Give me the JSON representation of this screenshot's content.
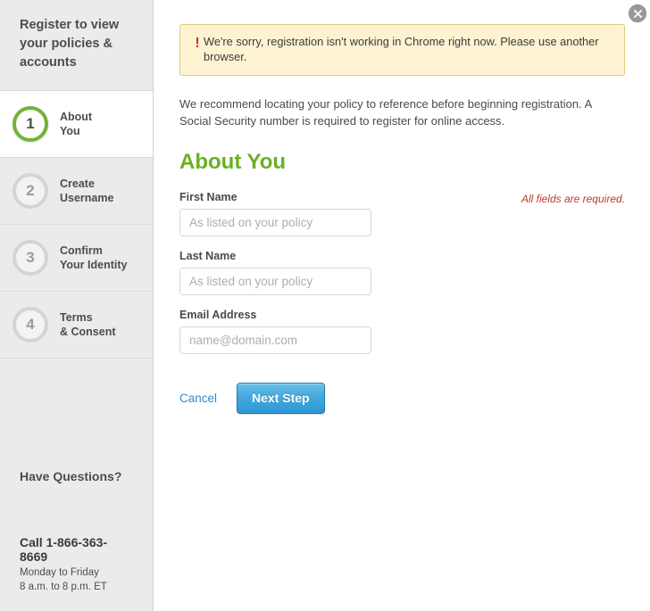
{
  "window": {
    "close_icon": "close-icon"
  },
  "sidebar": {
    "title": "Register to view your policies & accounts",
    "steps": [
      {
        "number": "1",
        "label": "About\nYou",
        "active": true
      },
      {
        "number": "2",
        "label": "Create\nUsername",
        "active": false
      },
      {
        "number": "3",
        "label": "Confirm\nYour Identity",
        "active": false
      },
      {
        "number": "4",
        "label": "Terms\n& Consent",
        "active": false
      }
    ],
    "help": {
      "title": "Have Questions?",
      "phone": "Call 1-866-363-8669",
      "hours_line1": "Monday to Friday",
      "hours_line2": "8 a.m. to 8 p.m. ET"
    }
  },
  "main": {
    "alert": {
      "icon": "exclamation-icon",
      "text": "We're sorry, registration isn't working in Chrome right now. Please use another browser."
    },
    "intro": "We recommend locating your policy to reference before beginning registration. A Social Security number is required to register for online access.",
    "section_title": "About You",
    "required_note": "All fields are required.",
    "fields": [
      {
        "label": "First Name",
        "value": "",
        "placeholder": "As listed on your policy"
      },
      {
        "label": "Last Name",
        "value": "",
        "placeholder": "As listed on your policy"
      },
      {
        "label": "Email Address",
        "value": "",
        "placeholder": "name@domain.com"
      }
    ],
    "actions": {
      "cancel_label": "Cancel",
      "next_label": "Next Step"
    }
  },
  "colors": {
    "accent_green": "#6ab023",
    "accent_blue": "#2e8ccf",
    "alert_bg": "#fdf3d2",
    "alert_border": "#e2ca7e",
    "error_red": "#c0392b",
    "sidebar_bg": "#ebebeb"
  }
}
